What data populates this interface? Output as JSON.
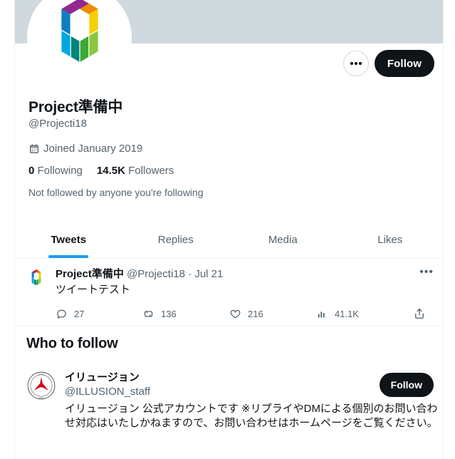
{
  "theme": {
    "banner_color": "#cfd9de",
    "accent_color": "#1d9bf0",
    "text_primary": "#0f1419",
    "text_secondary": "#536471",
    "button_bg": "#0f1419",
    "border_color": "#eff3f4"
  },
  "header": {
    "more_options_label": "More",
    "follow_label": "Follow"
  },
  "profile": {
    "display_name": "Project準備中",
    "handle": "@Projecti18",
    "joined": "Joined January 2019",
    "joined_icon": "calendar-icon",
    "following_count": "0",
    "following_label": "Following",
    "followers_count": "14.5K",
    "followers_label": "Followers",
    "not_followed_note": "Not followed by anyone you're following"
  },
  "tabs": [
    {
      "label": "Tweets",
      "active": true
    },
    {
      "label": "Replies",
      "active": false
    },
    {
      "label": "Media",
      "active": false
    },
    {
      "label": "Likes",
      "active": false
    }
  ],
  "tweet": {
    "author_name": "Project準備中",
    "author_handle": "@Projecti18",
    "separator": "·",
    "date": "Jul 21",
    "text": "ツイートテスト",
    "more_glyph": "•••",
    "metrics": [
      {
        "icon": "reply-icon",
        "value": "27"
      },
      {
        "icon": "retweet-icon",
        "value": "136"
      },
      {
        "icon": "like-icon",
        "value": "216"
      },
      {
        "icon": "views-icon",
        "value": "41.1K"
      }
    ],
    "share_icon": "share-icon"
  },
  "who_to_follow": {
    "heading": "Who to follow",
    "suggestion": {
      "name": "イリュージョン",
      "handle": "@ILLUSION_staff",
      "bio": "イリュージョン 公式アカウントです ※リプライやDMによる個別のお問い合わせ対応はいたしかねますので、お問い合わせはホームページをご覧ください。",
      "follow_label": "Follow"
    }
  }
}
